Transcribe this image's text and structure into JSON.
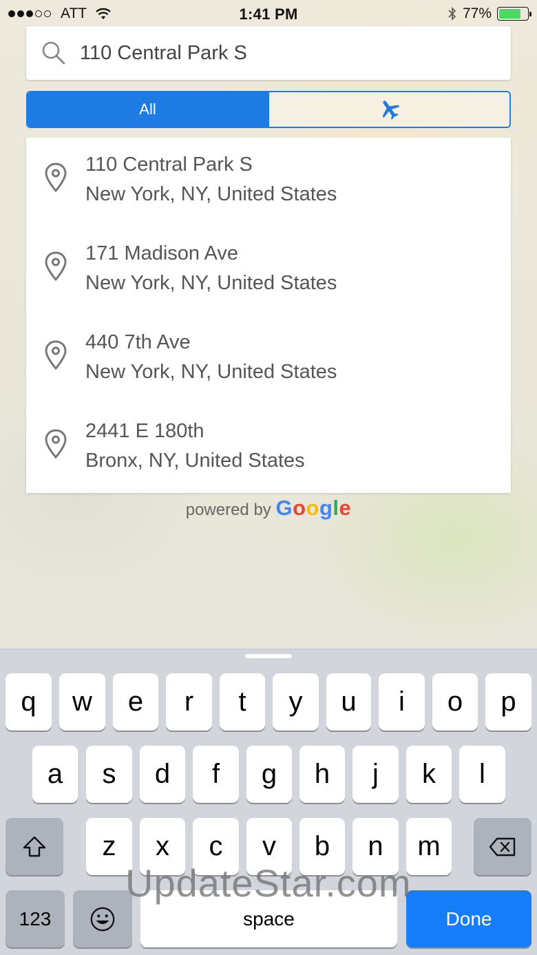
{
  "status_bar": {
    "carrier": "ATT",
    "time": "1:41 PM",
    "battery_percent": "77%",
    "battery_level": 0.77,
    "signal_bars_filled": 3,
    "signal_bars_total": 5
  },
  "search": {
    "value": "110 Central Park S",
    "icon": "search-icon"
  },
  "filter_tabs": [
    {
      "label": "All",
      "selected": true
    },
    {
      "label": "",
      "icon": "airplane-icon",
      "selected": false
    }
  ],
  "results": [
    {
      "line1": "110 Central Park S",
      "line2": "New York, NY, United States",
      "icon": "map-pin-icon"
    },
    {
      "line1": "171 Madison Ave",
      "line2": "New York, NY, United States",
      "icon": "map-pin-icon"
    },
    {
      "line1": "440 7th Ave",
      "line2": "New York, NY, United States",
      "icon": "map-pin-icon"
    },
    {
      "line1": "2441 E 180th",
      "line2": "Bronx, NY, United States",
      "icon": "map-pin-icon"
    }
  ],
  "attribution": {
    "prefix": "powered by ",
    "brand_letters": [
      "G",
      "o",
      "o",
      "g",
      "l",
      "e"
    ],
    "brand_colors": [
      "#4285F4",
      "#EA4335",
      "#FBBC05",
      "#4285F4",
      "#34A853",
      "#EA4335"
    ]
  },
  "keyboard": {
    "row1": [
      "q",
      "w",
      "e",
      "r",
      "t",
      "y",
      "u",
      "i",
      "o",
      "p"
    ],
    "row2": [
      "a",
      "s",
      "d",
      "f",
      "g",
      "h",
      "j",
      "k",
      "l"
    ],
    "row3": [
      "z",
      "x",
      "c",
      "v",
      "b",
      "n",
      "m"
    ],
    "numbers_label": "123",
    "space_label": "space",
    "done_label": "Done",
    "shift_icon": "shift-icon",
    "delete_icon": "backspace-icon",
    "emoji_icon": "emoji-icon"
  },
  "watermark": "UpdateStar.com",
  "colors": {
    "accent": "#1e7be4",
    "done_key": "#167efb",
    "battery": "#4cd964"
  }
}
